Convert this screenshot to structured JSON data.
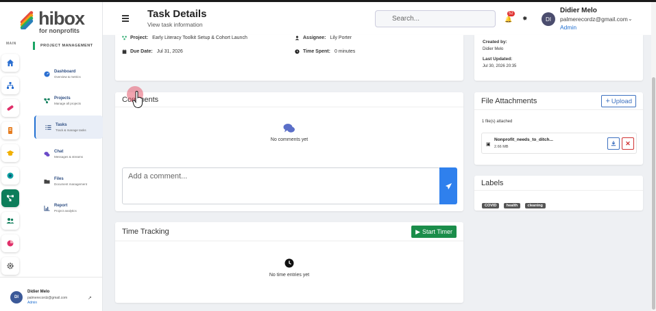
{
  "app": {
    "brand": "hibox",
    "brand_sub": "for nonprofits"
  },
  "rail": {
    "main_label": "MAIN",
    "section_label": "PROJECT MANAGEMENT",
    "menu": [
      {
        "title": "Dashboard",
        "sub": "Overview & metrics"
      },
      {
        "title": "Projects",
        "sub": "Manage all projects"
      },
      {
        "title": "Tasks",
        "sub": "Track & manage tasks"
      },
      {
        "title": "Chat",
        "sub": "Messages & streams"
      },
      {
        "title": "Files",
        "sub": "Document management"
      },
      {
        "title": "Report",
        "sub": "Project analytics"
      }
    ],
    "user": {
      "initials": "DI",
      "name": "Didier Melo",
      "email": "palmerecordz@gmail.com",
      "role": "Admin"
    }
  },
  "header": {
    "title": "Task Details",
    "subtitle": "View task information",
    "search_placeholder": "Search...",
    "notif_count": "52",
    "user": {
      "initials": "DI",
      "name": "Didier Melo",
      "email": "palmerecordz@gmail.com",
      "role": "Admin"
    }
  },
  "task": {
    "project_label": "Project:",
    "project": "Early Literacy Toolkit Setup & Cohort Launch",
    "assignee_label": "Assignee:",
    "assignee": "Lily Porter",
    "due_label": "Due Date:",
    "due": "Jul 31, 2026",
    "time_label": "Time Spent:",
    "time": "0 minutes",
    "created_by_label": "Created by:",
    "created_by": "Didier Melo",
    "last_updated_label": "Last Updated:",
    "last_updated": "Jul 30, 2026 20:35"
  },
  "comments": {
    "title": "Comments",
    "empty": "No comments yet",
    "placeholder": "Add a comment..."
  },
  "time_tracking": {
    "title": "Time Tracking",
    "start_label": "Start Timer",
    "empty": "No time entries yet"
  },
  "attachments": {
    "title": "File Attachments",
    "upload_label": "Upload",
    "count_text": "1 file(s) attached",
    "files": [
      {
        "name": "Nonprofit_needs_to_ditch...",
        "size": "2.66 MB"
      }
    ]
  },
  "labels": {
    "title": "Labels",
    "tags": [
      "COVID",
      "health",
      "cleaning"
    ]
  },
  "colors": {
    "accent": "#1f6fd1",
    "brand_green": "#1aa564",
    "timer_green": "#1a8d4a",
    "send_blue": "#2f80ed"
  }
}
